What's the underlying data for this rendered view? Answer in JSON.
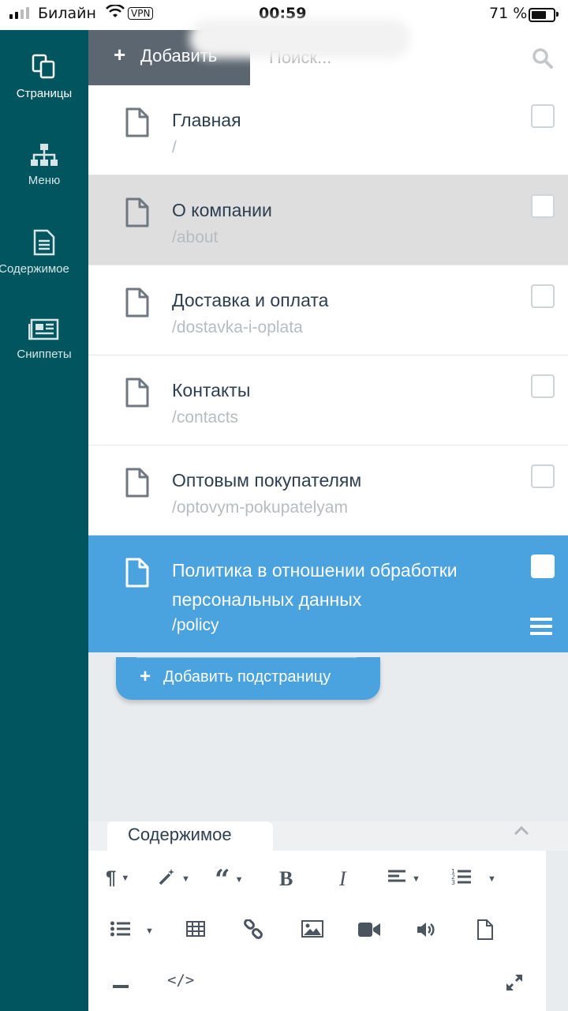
{
  "status_bar": {
    "carrier": "Билайн",
    "vpn": "VPN",
    "time": "00:59",
    "battery": "71 %",
    "battery_level": 0.71
  },
  "sidebar": {
    "items": [
      {
        "label": "Страницы",
        "icon": "pages-icon",
        "active": true
      },
      {
        "label": "Меню",
        "icon": "sitemap-icon",
        "active": false
      },
      {
        "label": "Содержимое",
        "icon": "content-icon",
        "active": false
      },
      {
        "label": "Сниппеты",
        "icon": "snippets-icon",
        "active": false
      }
    ]
  },
  "toolbar": {
    "add_label": "Добавить",
    "search_placeholder": "Поиск..."
  },
  "pages": [
    {
      "title": "Главная",
      "slug": "/",
      "state": "normal"
    },
    {
      "title": "О компании",
      "slug": "/about",
      "state": "highlighted"
    },
    {
      "title": "Доставка и оплата",
      "slug": "/dostavka-i-oplata",
      "state": "normal"
    },
    {
      "title": "Контакты",
      "slug": "/contacts",
      "state": "normal"
    },
    {
      "title": "Оптовым покупателям",
      "slug": "/optovym-pokupatelyam",
      "state": "normal"
    },
    {
      "title": "Политика в отношении обработки персональных данных",
      "slug": "/policy",
      "state": "selected"
    }
  ],
  "add_subpage_label": "Добавить подстраницу",
  "editor": {
    "tab_label": "Содержимое",
    "tools": [
      "paragraph-icon",
      "magic-icon",
      "quote-icon",
      "bold-icon",
      "italic-icon",
      "align-icon",
      "ordered-list-icon",
      "unordered-list-icon",
      "table-icon",
      "link-icon",
      "image-icon",
      "video-icon",
      "audio-icon",
      "file-icon",
      "horizontal-rule-icon",
      "code-icon",
      "fullscreen-icon"
    ]
  },
  "colors": {
    "sidebar": "#00555f",
    "selected_row": "#4aa3df",
    "add_button": "#5c6670"
  }
}
